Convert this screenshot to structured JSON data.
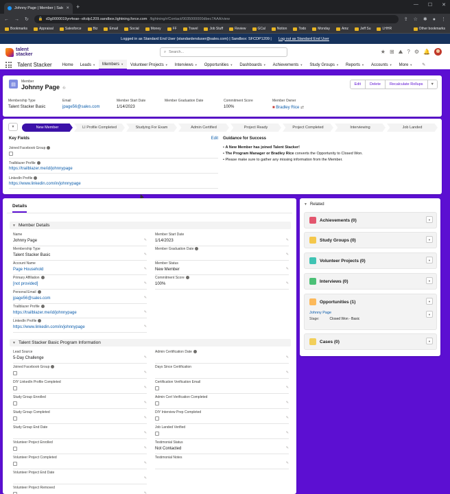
{
  "browser": {
    "tab_title": "Johnny Page | Member | Salesfo",
    "url_host": "d3g0000019yn4eae--sfcdp1209.sandbox.lightning.force.com",
    "url_path": "/lightning/r/Contact/0035000000dbec7AAA/view",
    "bookmarks": [
      "Bookmarks",
      "Appraisal",
      "Salesforce",
      "Biz",
      "Email",
      "Social",
      "Money",
      "FF",
      "Travel",
      "Job Stuff",
      "Review",
      "GCal",
      "Notion",
      "Todo",
      "Monday",
      "Amz",
      "Jeff Su",
      "LHHR"
    ],
    "other_bookmarks": "Other bookmarks"
  },
  "login_banner": {
    "text": "Logged in as Standard End User (standardenduser@sales.com) | Sandbox: SFCDP1209 |",
    "logout": "Log out as Standard End User"
  },
  "app": {
    "logo_line1": "talent",
    "logo_line2": "stacker",
    "search_placeholder": "Search...",
    "name": "Talent Stacker"
  },
  "nav": [
    "Home",
    "Leads",
    "Members",
    "Volunteer Projects",
    "Interviews",
    "Opportunities",
    "Dashboards",
    "Achievements",
    "Study Groups",
    "Reports",
    "Accounts",
    "More"
  ],
  "record": {
    "object": "Member",
    "name": "Johnny Page",
    "actions": [
      "Edit",
      "Delete",
      "Recalculate Rollups"
    ],
    "highlights": [
      {
        "label": "Membership Type",
        "value": "Talent Stacker Basic"
      },
      {
        "label": "Email",
        "value": "jpage56@sales.com"
      },
      {
        "label": "Member Start Date",
        "value": "1/14/2023"
      },
      {
        "label": "Member Graduation Date",
        "value": ""
      },
      {
        "label": "Commitment Score",
        "value": "100%"
      },
      {
        "label": "Member Owner",
        "value": "Bradley Rice"
      }
    ]
  },
  "path": {
    "steps": [
      "New Member",
      "LI Profile Completed",
      "Studying For Exam",
      "Admin Certified",
      "Project Ready",
      "Project Completed",
      "Interviewing",
      "Job Landed"
    ]
  },
  "key_fields": {
    "title": "Key Fields",
    "edit": "Edit",
    "fields": [
      {
        "label": "Joined Facebook Group",
        "value": ""
      },
      {
        "label": "Trailblazer Profile",
        "value": "https://trailblazer.me/id/johnnypage"
      },
      {
        "label": "LinkedIn Profile",
        "value": "https://www.linkedin.com/in/johnnypage"
      }
    ]
  },
  "guidance": {
    "title": "Guidance for Success",
    "line1": "A New Member has joined Talent Stacker!",
    "line2_bold": "The Program Manager or Bradley Rice",
    "line2_rest": " converts the Opportunity to Closed Won.",
    "line3": "Please make sure to gather any missing information from the Member."
  },
  "details": {
    "tab": "Details",
    "section1": "Member Details",
    "left1": [
      {
        "label": "Name",
        "value": "Johnny Page"
      },
      {
        "label": "Membership Type",
        "value": "Talent Stacker Basic"
      },
      {
        "label": "Account Name",
        "value": "Page Household"
      },
      {
        "label": "Primary Affiliation",
        "value": "[not provided]"
      },
      {
        "label": "Personal Email",
        "value": "jpage56@sales.com"
      },
      {
        "label": "Trailblazer Profile",
        "value": "https://trailblazer.me/id/johnnypage"
      },
      {
        "label": "LinkedIn Profile",
        "value": "https://www.linkedin.com/in/johnnypage"
      }
    ],
    "right1": [
      {
        "label": "Member Start Date",
        "value": "1/14/2023"
      },
      {
        "label": "Member Graduation Date",
        "value": ""
      },
      {
        "label": "Member Status",
        "value": "New Member"
      },
      {
        "label": "Commitment Score",
        "value": "100%"
      }
    ],
    "section2": "Talent Stacker Basic Program Information",
    "left2": [
      {
        "label": "Lead Source",
        "value": "5-Day Challenge"
      },
      {
        "label": "Joined Facebook Group",
        "value": ""
      },
      {
        "label": "DIY LinkedIn Profile Completed",
        "value": ""
      },
      {
        "label": "Study Group Enrolled",
        "value": ""
      },
      {
        "label": "Study Group Completed",
        "value": ""
      },
      {
        "label": "Study Group End Date",
        "value": ""
      },
      {
        "label": "Volunteer Project Enrolled",
        "value": ""
      },
      {
        "label": "Volunteer Project Completed",
        "value": ""
      },
      {
        "label": "Volunteer Project End Date",
        "value": ""
      },
      {
        "label": "Volunteer Project Removed",
        "value": ""
      }
    ],
    "right2": [
      {
        "label": "Admin Certification Date",
        "value": ""
      },
      {
        "label": "Days Since Certification",
        "value": ""
      },
      {
        "label": "Certification Verification Email",
        "value": ""
      },
      {
        "label": "Admin Cert Verification Completed",
        "value": ""
      },
      {
        "label": "DIY Interview Prep Completed",
        "value": ""
      },
      {
        "label": "Job Landed Verified",
        "value": ""
      },
      {
        "label": "Testimonial Status",
        "value": "Not Contacted"
      },
      {
        "label": "Testimonial Notes",
        "value": ""
      }
    ]
  },
  "related": {
    "title": "Related",
    "items": [
      {
        "label": "Achievements (0)",
        "color": "#e3566e"
      },
      {
        "label": "Study Groups (0)",
        "color": "#f4c74b"
      },
      {
        "label": "Volunteer Projects (0)",
        "color": "#3fc3b3"
      },
      {
        "label": "Interviews (0)",
        "color": "#4bc076"
      },
      {
        "label": "Opportunities (1)",
        "color": "#fcb95b"
      },
      {
        "label": "Cases (0)",
        "color": "#f2cf5b"
      }
    ],
    "opportunity": {
      "name": "Johnny Page",
      "stage_label": "Stage:",
      "stage_value": "Closed Won - Basic"
    }
  }
}
